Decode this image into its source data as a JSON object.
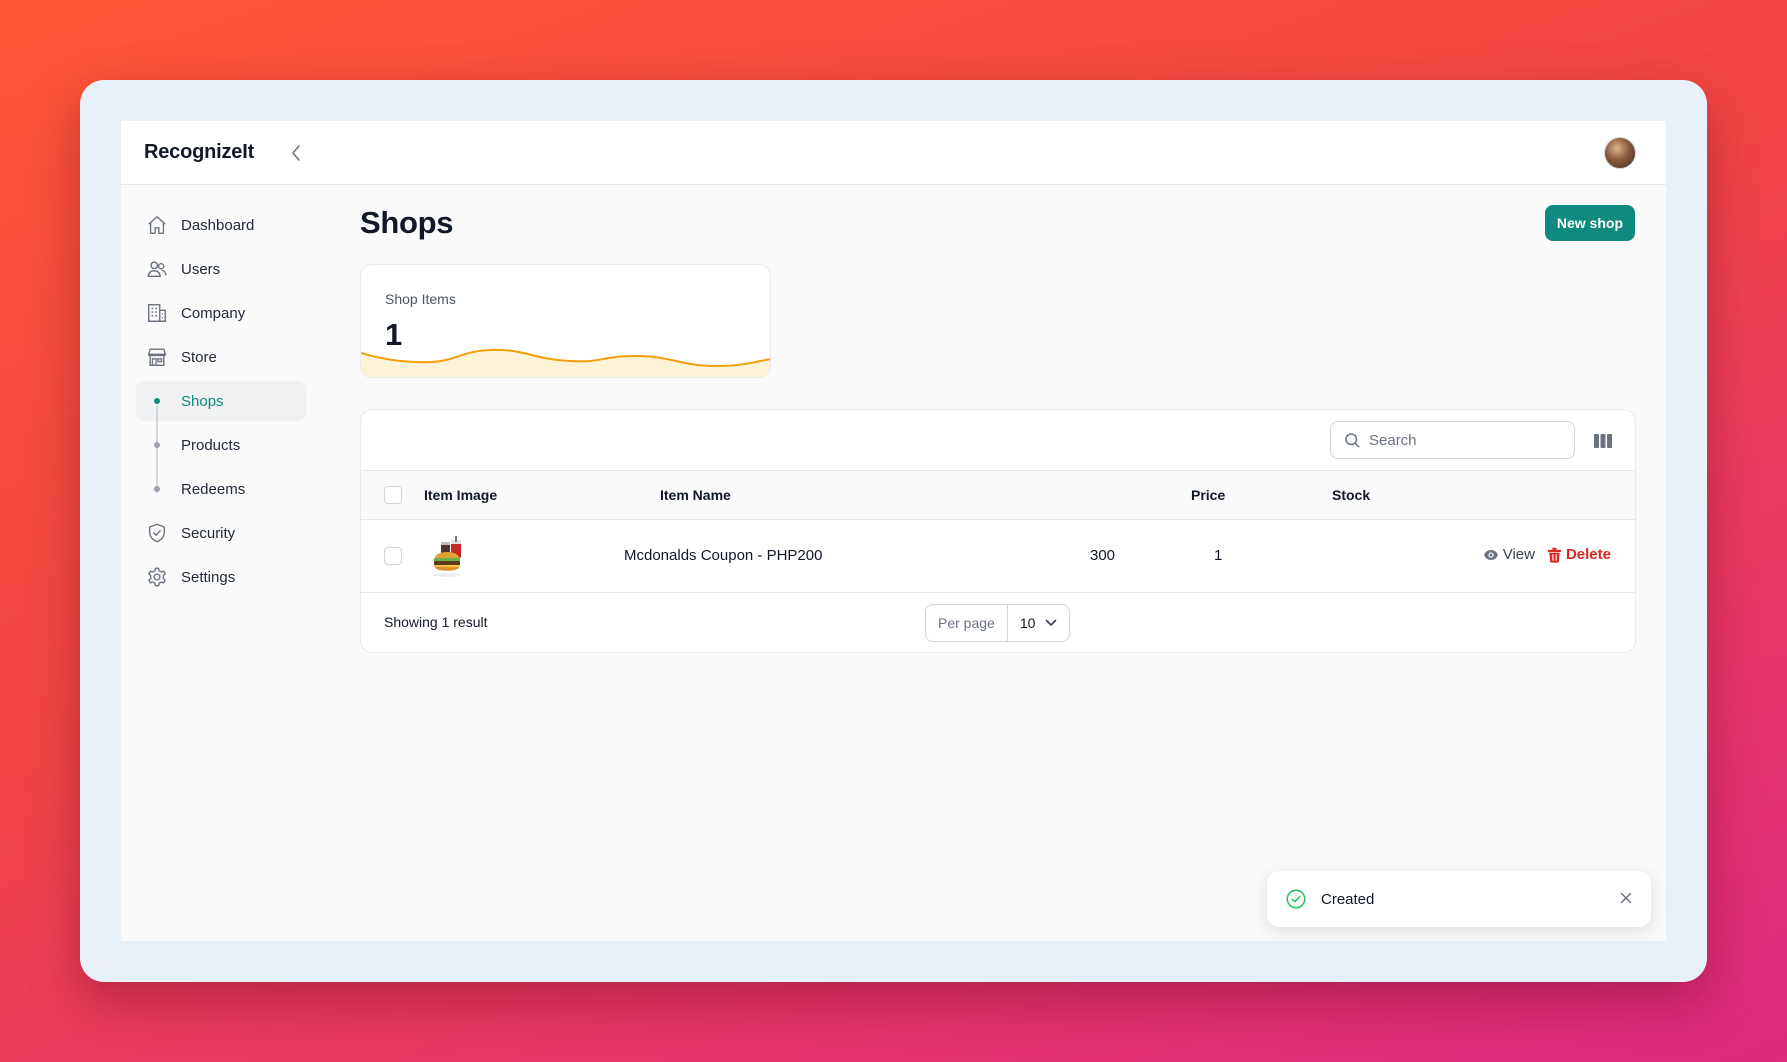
{
  "app": {
    "brand": "RecognizeIt"
  },
  "sidebar": {
    "items": [
      {
        "label": "Dashboard",
        "icon": "home-icon"
      },
      {
        "label": "Users",
        "icon": "users-icon"
      },
      {
        "label": "Company",
        "icon": "building-icon"
      },
      {
        "label": "Store",
        "icon": "store-icon"
      },
      {
        "label": "Shops",
        "icon": "dot",
        "sub": true,
        "active": true
      },
      {
        "label": "Products",
        "icon": "dot",
        "sub": true
      },
      {
        "label": "Redeems",
        "icon": "dot",
        "sub": true
      },
      {
        "label": "Security",
        "icon": "shield-icon"
      },
      {
        "label": "Settings",
        "icon": "gear-icon"
      }
    ]
  },
  "page": {
    "title": "Shops",
    "new_button": "New shop"
  },
  "stats": {
    "label": "Shop Items",
    "value": "1"
  },
  "table": {
    "search_placeholder": "Search",
    "columns": [
      "Item Image",
      "Item Name",
      "Price",
      "Stock"
    ],
    "rows": [
      {
        "image": "burger-meal-image",
        "name": "Mcdonalds Coupon - PHP200",
        "price": "300",
        "stock": "1"
      }
    ],
    "actions": {
      "view": "View",
      "delete": "Delete"
    },
    "footer": {
      "showing": "Showing 1 result",
      "per_page_label": "Per page",
      "per_page_value": "10"
    }
  },
  "toast": {
    "message": "Created"
  },
  "colors": {
    "accent": "#0f8a7f",
    "danger": "#dc2626",
    "chart": "#f59e0b"
  }
}
